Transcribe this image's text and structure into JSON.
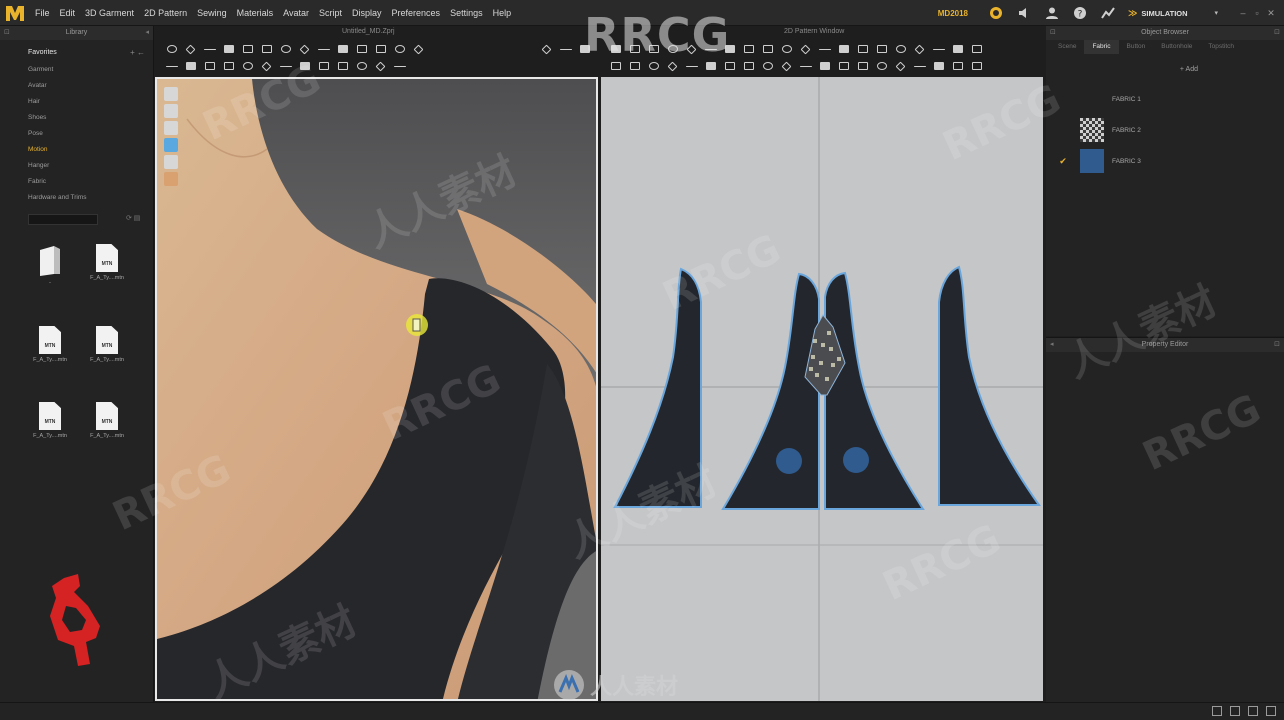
{
  "app": {
    "logo": "M",
    "version": "MD2018",
    "mode": "SIMULATION"
  },
  "menu": [
    "File",
    "Edit",
    "3D Garment",
    "2D Pattern",
    "Sewing",
    "Materials",
    "Avatar",
    "Script",
    "Display",
    "Preferences",
    "Settings",
    "Help"
  ],
  "library": {
    "title": "Library",
    "favorites": "Favorites",
    "items": [
      "Garment",
      "Avatar",
      "Hair",
      "Shoes",
      "Pose",
      "Motion",
      "Hanger",
      "Fabric",
      "Hardware and Trims"
    ],
    "active_item": "Motion",
    "files": [
      {
        "type": "folder",
        "caption": ".."
      },
      {
        "type": "file",
        "badge": "MTN",
        "caption": "F_A_Ty....mtn"
      },
      {
        "type": "file",
        "badge": "MTN",
        "caption": "F_A_Ty....mtn"
      },
      {
        "type": "file",
        "badge": "MTN",
        "caption": "F_A_Ty....mtn"
      },
      {
        "type": "file",
        "badge": "MTN",
        "caption": "F_A_Ty....mtn"
      },
      {
        "type": "file",
        "badge": "MTN",
        "caption": "F_A_Ty....mtn"
      }
    ]
  },
  "viewport3d": {
    "title": "Untitled_MD.Zprj"
  },
  "viewport2d": {
    "title": "2D Pattern Window"
  },
  "object_browser": {
    "title": "Object Browser",
    "tabs": [
      "Scene",
      "Fabric",
      "Button",
      "Buttonhole",
      "Topstitch"
    ],
    "active_tab": "Fabric",
    "add_label": "+ Add",
    "fabrics": [
      {
        "name": "FABRIC 1",
        "swatch": "none",
        "checked": false
      },
      {
        "name": "FABRIC 2",
        "swatch": "checker",
        "checked": false
      },
      {
        "name": "FABRIC 3",
        "swatch": "#2f5b8e",
        "checked": true
      }
    ]
  },
  "property_editor": {
    "title": "Property Editor"
  },
  "colors": {
    "accent": "#e9b32c",
    "fabric_dark": "#23262c",
    "pattern_outline": "#6aa6dc",
    "button_blue": "#2f5b8e"
  },
  "watermark": {
    "main": "RRCG",
    "bottom": "人人素材"
  }
}
